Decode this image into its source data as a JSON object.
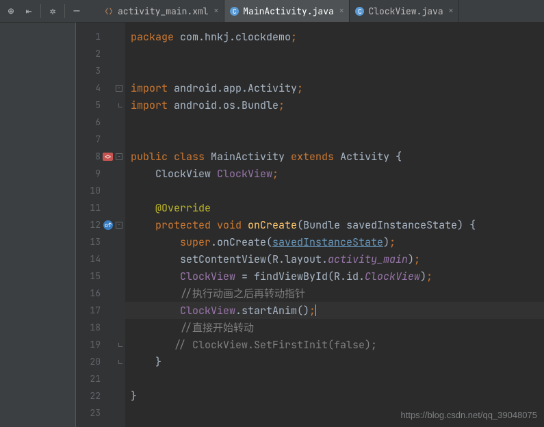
{
  "toolbar": {
    "icons": [
      "target",
      "back",
      "settings",
      "minimize"
    ]
  },
  "tabs": [
    {
      "label": "activity_main.xml",
      "type": "xml",
      "active": false
    },
    {
      "label": "MainActivity.java",
      "type": "java",
      "active": true
    },
    {
      "label": "ClockView.java",
      "type": "java",
      "active": false
    }
  ],
  "lines": [
    {
      "n": 1,
      "tokens": [
        [
          "kw",
          "package"
        ],
        [
          "",
          ""
        ],
        [
          "ident",
          " com.hnkj.clockdemo"
        ],
        [
          "semi",
          ";"
        ]
      ]
    },
    {
      "n": 2,
      "tokens": []
    },
    {
      "n": 3,
      "tokens": []
    },
    {
      "n": 4,
      "tokens": [
        [
          "kw",
          "import"
        ],
        [
          "ident",
          " android.app.Activity"
        ],
        [
          "semi",
          ";"
        ]
      ],
      "fold": "start"
    },
    {
      "n": 5,
      "tokens": [
        [
          "kw",
          "import"
        ],
        [
          "ident",
          " android.os.Bundle"
        ],
        [
          "semi",
          ";"
        ]
      ],
      "fold": "end"
    },
    {
      "n": 6,
      "tokens": []
    },
    {
      "n": 7,
      "tokens": []
    },
    {
      "n": 8,
      "tokens": [
        [
          "kw",
          "public "
        ],
        [
          "kw",
          "class "
        ],
        [
          "ident",
          "MainActivity "
        ],
        [
          "kw",
          "extends "
        ],
        [
          "ident",
          "Activity "
        ],
        [
          "ident",
          "{"
        ]
      ],
      "icon": "class",
      "fold": "start"
    },
    {
      "n": 9,
      "tokens": [
        [
          "",
          "    "
        ],
        [
          "ident",
          "ClockView "
        ],
        [
          "mem-purple",
          "ClockView"
        ],
        [
          "semi",
          ";"
        ]
      ]
    },
    {
      "n": 10,
      "tokens": []
    },
    {
      "n": 11,
      "tokens": [
        [
          "",
          "    "
        ],
        [
          "anno",
          "@Override"
        ]
      ]
    },
    {
      "n": 12,
      "tokens": [
        [
          "",
          "    "
        ],
        [
          "kw",
          "protected "
        ],
        [
          "kw",
          "void "
        ],
        [
          "fn",
          "onCreate"
        ],
        [
          "ident",
          "(Bundle savedInstanceState) {"
        ]
      ],
      "icon": "override",
      "fold": "start"
    },
    {
      "n": 13,
      "tokens": [
        [
          "",
          "        "
        ],
        [
          "kw",
          "super"
        ],
        [
          "ident",
          ".onCreate("
        ],
        [
          "underline",
          "savedInstanceState"
        ],
        [
          "ident",
          ")"
        ],
        [
          "semi",
          ";"
        ]
      ]
    },
    {
      "n": 14,
      "tokens": [
        [
          "",
          "        "
        ],
        [
          "ident",
          "setContentView(R.layout."
        ],
        [
          "str-mem",
          "activity_main"
        ],
        [
          "ident",
          ")"
        ],
        [
          "semi",
          ";"
        ]
      ]
    },
    {
      "n": 15,
      "tokens": [
        [
          "",
          "        "
        ],
        [
          "mem-purple",
          "ClockView"
        ],
        [
          "ident",
          " = findViewById(R.id."
        ],
        [
          "str-mem",
          "ClockView"
        ],
        [
          "ident",
          ")"
        ],
        [
          "semi",
          ";"
        ]
      ]
    },
    {
      "n": 16,
      "tokens": [
        [
          "",
          "        "
        ],
        [
          "cmt",
          "//执行动画之后再转动指针"
        ]
      ]
    },
    {
      "n": 17,
      "tokens": [
        [
          "",
          "        "
        ],
        [
          "mem-purple",
          "ClockView"
        ],
        [
          "ident",
          ".startAnim()"
        ],
        [
          "semi",
          ";"
        ]
      ],
      "current": true
    },
    {
      "n": 18,
      "tokens": [
        [
          "",
          "        "
        ],
        [
          "cmt",
          "//直接开始转动"
        ]
      ]
    },
    {
      "n": 19,
      "tokens": [
        [
          "",
          "       "
        ],
        [
          "cmt",
          "// ClockView.SetFirstInit(false);"
        ]
      ],
      "fold": "end"
    },
    {
      "n": 20,
      "tokens": [
        [
          "",
          "    "
        ],
        [
          "ident",
          "}"
        ]
      ],
      "fold": "end"
    },
    {
      "n": 21,
      "tokens": []
    },
    {
      "n": 22,
      "tokens": [
        [
          "ident",
          "}"
        ]
      ]
    },
    {
      "n": 23,
      "tokens": []
    }
  ],
  "watermark": "https://blog.csdn.net/qq_39048075"
}
